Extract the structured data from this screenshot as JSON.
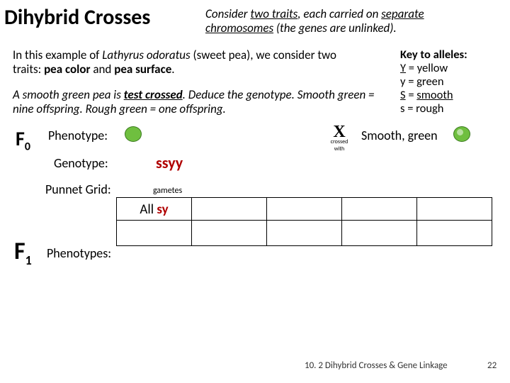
{
  "title": "Dihybrid Crosses",
  "subtitle_pre": "Consider ",
  "subtitle_u1": "two traits",
  "subtitle_mid": ", each carried on ",
  "subtitle_u2": "separate chromosomes",
  "subtitle_post": " (the genes are unlinked).",
  "intro_p1a": "In this example of ",
  "intro_p1b": "Lathyrus odoratus",
  "intro_p1c": " (sweet pea), we consider two traits: ",
  "intro_p1d": "pea color",
  "intro_p1e": " and ",
  "intro_p1f": "pea surface",
  "intro_p1g": ".",
  "task_a": "A smooth green pea is ",
  "task_b": "test crossed",
  "task_c": ". Deduce the genotype. Smooth green = nine offspring. Rough green = one offspring.",
  "key_title": "Key to alleles:",
  "key_Y": "Y",
  "key_Y_txt": " = yellow",
  "key_y": "y",
  "key_y_txt": " = green",
  "key_S": "S",
  "key_S_txt": " = ",
  "key_S_u": "smooth",
  "key_s": "s",
  "key_s_txt": " = rough",
  "F0_label": "F",
  "F0_sub": "0",
  "F1_label": "F",
  "F1_sub": "1",
  "lbl_pheno": "Phenotype:",
  "lbl_geno": "Genotype:",
  "lbl_punn": "Punnet Grid:",
  "lbl_phenos": "Phenotypes:",
  "smooth_green": "Smooth, green",
  "x_label": "crossed with",
  "ssyy": "ssyy",
  "gametes": "gametes",
  "all": "All ",
  "sy": "sy",
  "footer": "10. 2 Dihybrid Crosses & Gene Linkage",
  "page": "22"
}
